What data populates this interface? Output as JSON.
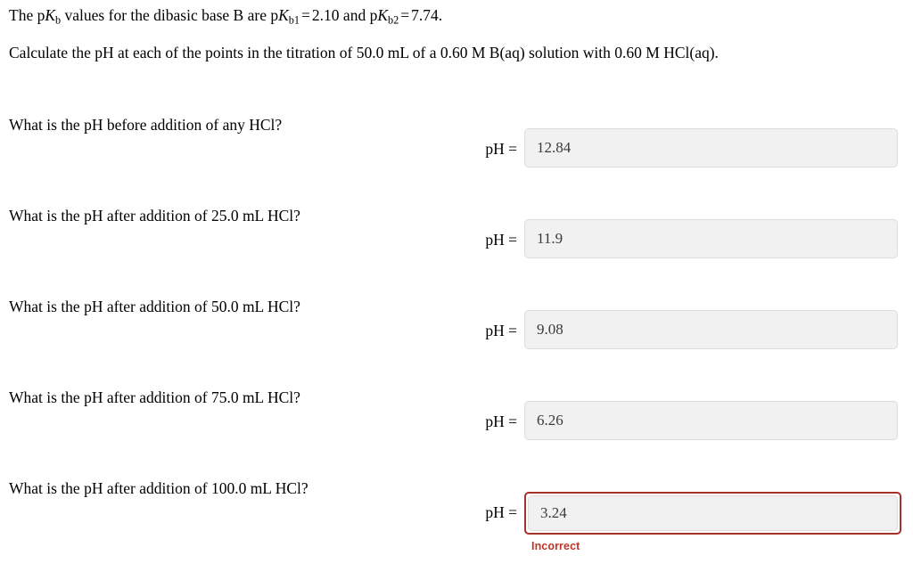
{
  "problem": {
    "line1": {
      "prefix": "The p",
      "sym1": "K",
      "sub1": "b",
      "mid1": " values for the dibasic base B are p",
      "sym2": "K",
      "sub2": "b1",
      "eq1": "=",
      "val1": "2.10",
      "mid2": "and p",
      "sym3": "K",
      "sub3": "b2",
      "eq2": "=",
      "val2": "7.74.",
      "and": "and"
    },
    "line2": "Calculate the pH at each of the points in the titration of 50.0 mL of a 0.60 M B(aq) solution with 0.60 M HCl(aq)."
  },
  "ph_label": "pH =",
  "questions": [
    {
      "prompt": "What is the pH before addition of any HCl?",
      "value": "12.84",
      "placeholder": "",
      "status": "",
      "incorrect": false
    },
    {
      "prompt": "What is the pH after addition of 25.0 mL HCl?",
      "value": "11.9",
      "placeholder": "",
      "status": "",
      "incorrect": false
    },
    {
      "prompt": "What is the pH after addition of 50.0 mL HCl?",
      "value": "9.08",
      "placeholder": "",
      "status": "",
      "incorrect": false
    },
    {
      "prompt": "What is the pH after addition of 75.0 mL HCl?",
      "value": "6.26",
      "placeholder": "",
      "status": "",
      "incorrect": false
    },
    {
      "prompt": "What is the pH after addition of 100.0 mL HCl?",
      "value": "3.24",
      "placeholder": "",
      "status": "Incorrect",
      "incorrect": true
    }
  ],
  "colors": {
    "incorrect_border": "#a3322a",
    "incorrect_text": "#bf3426",
    "field_background": "#f1f1f1",
    "field_border": "#dcdcdc"
  }
}
